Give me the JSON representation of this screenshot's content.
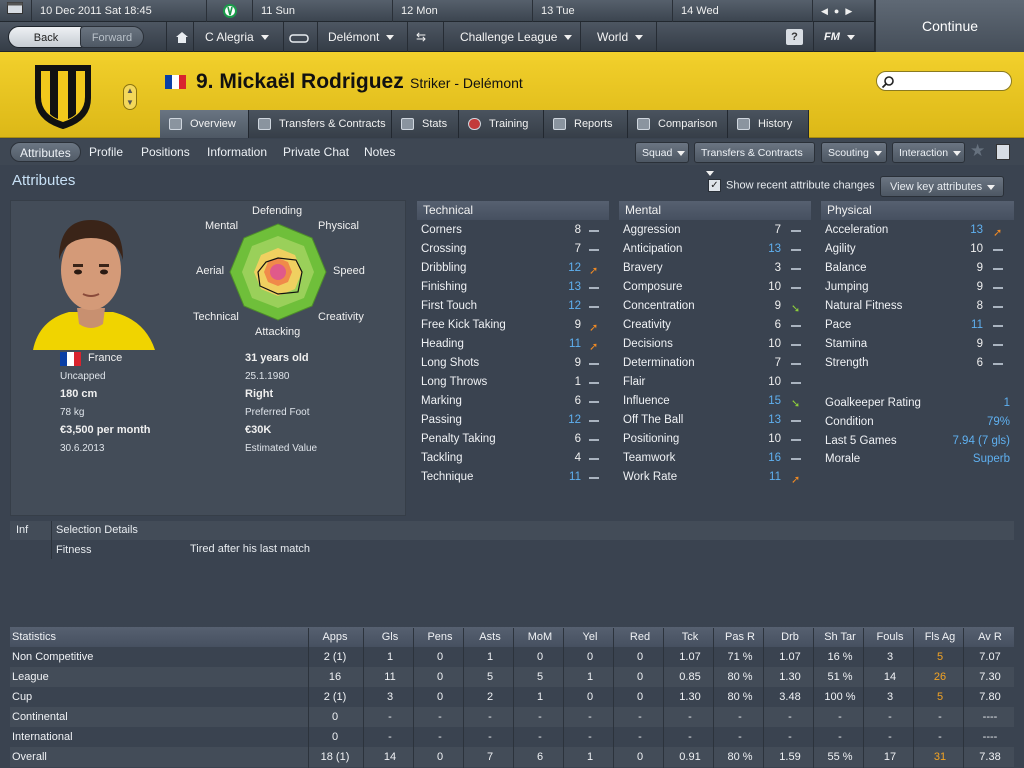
{
  "topbar": {
    "date": "10 Dec 2011 Sat  18:45",
    "days": [
      "11 Sun",
      "12 Mon",
      "13 Tue",
      "14 Wed"
    ]
  },
  "nav": {
    "back": "Back",
    "forward": "Forward",
    "club": "C Alegria",
    "team": "Delémont",
    "competition": "Challenge League",
    "world": "World",
    "help": "?",
    "fm": "FM",
    "continue": "Continue"
  },
  "player": {
    "name": "9. Mickaël Rodriguez",
    "role": "Striker - Delémont",
    "nationality": "France",
    "caps": "Uncapped",
    "height": "180 cm",
    "weight": "78 kg",
    "wage": "€3,500 per month",
    "contract_end": "30.6.2013",
    "age": "31 years old",
    "dob": "25.1.1980",
    "foot": "Right",
    "foot_label": "Preferred Foot",
    "value": "€30K",
    "value_label": "Estimated Value"
  },
  "tabs": [
    "Overview",
    "Transfers & Contracts",
    "Stats",
    "Training",
    "Reports",
    "Comparison",
    "History"
  ],
  "subnav": {
    "items": [
      "Attributes",
      "Profile",
      "Positions",
      "Information",
      "Private Chat",
      "Notes"
    ],
    "buttons": [
      "Squad",
      "Transfers & Contracts",
      "Scouting",
      "Interaction"
    ]
  },
  "attributes": {
    "title": "Attributes",
    "show_recent": "Show recent attribute changes",
    "view_key": "View key attributes",
    "spider_labels": [
      "Defending",
      "Physical",
      "Speed",
      "Creativity",
      "Attacking",
      "Technical",
      "Aerial",
      "Mental"
    ],
    "technical_header": "Technical",
    "mental_header": "Mental",
    "physical_header": "Physical",
    "technical": [
      {
        "n": "Corners",
        "v": "8",
        "c": "w",
        "t": "flat"
      },
      {
        "n": "Crossing",
        "v": "7",
        "c": "w",
        "t": "flat"
      },
      {
        "n": "Dribbling",
        "v": "12",
        "c": "bl",
        "t": "up"
      },
      {
        "n": "Finishing",
        "v": "13",
        "c": "bl",
        "t": "flat"
      },
      {
        "n": "First Touch",
        "v": "12",
        "c": "bl",
        "t": "flat"
      },
      {
        "n": "Free Kick Taking",
        "v": "9",
        "c": "w",
        "t": "up"
      },
      {
        "n": "Heading",
        "v": "11",
        "c": "bl",
        "t": "up"
      },
      {
        "n": "Long Shots",
        "v": "9",
        "c": "w",
        "t": "flat"
      },
      {
        "n": "Long Throws",
        "v": "1",
        "c": "w",
        "t": "flat"
      },
      {
        "n": "Marking",
        "v": "6",
        "c": "w",
        "t": "flat"
      },
      {
        "n": "Passing",
        "v": "12",
        "c": "bl",
        "t": "flat"
      },
      {
        "n": "Penalty Taking",
        "v": "6",
        "c": "w",
        "t": "flat"
      },
      {
        "n": "Tackling",
        "v": "4",
        "c": "w",
        "t": "flat"
      },
      {
        "n": "Technique",
        "v": "11",
        "c": "bl",
        "t": "flat"
      }
    ],
    "mental": [
      {
        "n": "Aggression",
        "v": "7",
        "c": "w",
        "t": "flat"
      },
      {
        "n": "Anticipation",
        "v": "13",
        "c": "bl",
        "t": "flat"
      },
      {
        "n": "Bravery",
        "v": "3",
        "c": "w",
        "t": "flat"
      },
      {
        "n": "Composure",
        "v": "10",
        "c": "w",
        "t": "flat"
      },
      {
        "n": "Concentration",
        "v": "9",
        "c": "w",
        "t": "down"
      },
      {
        "n": "Creativity",
        "v": "6",
        "c": "w",
        "t": "flat"
      },
      {
        "n": "Decisions",
        "v": "10",
        "c": "w",
        "t": "flat"
      },
      {
        "n": "Determination",
        "v": "7",
        "c": "w",
        "t": "flat"
      },
      {
        "n": "Flair",
        "v": "10",
        "c": "w",
        "t": "flat"
      },
      {
        "n": "Influence",
        "v": "15",
        "c": "bl",
        "t": "down"
      },
      {
        "n": "Off The Ball",
        "v": "13",
        "c": "bl",
        "t": "flat"
      },
      {
        "n": "Positioning",
        "v": "10",
        "c": "w",
        "t": "flat"
      },
      {
        "n": "Teamwork",
        "v": "16",
        "c": "bl",
        "t": "flat"
      },
      {
        "n": "Work Rate",
        "v": "11",
        "c": "bl",
        "t": "up"
      }
    ],
    "physical": [
      {
        "n": "Acceleration",
        "v": "13",
        "c": "bl",
        "t": "up"
      },
      {
        "n": "Agility",
        "v": "10",
        "c": "w",
        "t": "flat"
      },
      {
        "n": "Balance",
        "v": "9",
        "c": "w",
        "t": "flat"
      },
      {
        "n": "Jumping",
        "v": "9",
        "c": "w",
        "t": "flat"
      },
      {
        "n": "Natural Fitness",
        "v": "8",
        "c": "w",
        "t": "flat"
      },
      {
        "n": "Pace",
        "v": "11",
        "c": "bl",
        "t": "flat"
      },
      {
        "n": "Stamina",
        "v": "9",
        "c": "w",
        "t": "flat"
      },
      {
        "n": "Strength",
        "v": "6",
        "c": "w",
        "t": "flat"
      }
    ],
    "extra": [
      {
        "n": "Goalkeeper Rating",
        "v": "1"
      },
      {
        "n": "Condition",
        "v": "79%"
      },
      {
        "n": "Last 5 Games",
        "v": "7.94 (7 gls)"
      },
      {
        "n": "Morale",
        "v": "Superb"
      }
    ]
  },
  "selection": {
    "col1": "Inf",
    "col2": "Selection Details",
    "row_label": "Fitness",
    "row_value": "Tired after his last match"
  },
  "stats": {
    "headers": [
      "Statistics",
      "Apps",
      "Gls",
      "Pens",
      "Asts",
      "MoM",
      "Yel",
      "Red",
      "Tck",
      "Pas R",
      "Drb",
      "Sh Tar",
      "Fouls",
      "Fls Ag",
      "Av R"
    ],
    "rows": [
      [
        "Non Competitive",
        "2 (1)",
        "1",
        "0",
        "1",
        "0",
        "0",
        "0",
        "1.07",
        "71 %",
        "1.07",
        "16 %",
        "3",
        "5",
        "7.07"
      ],
      [
        "League",
        "16",
        "11",
        "0",
        "5",
        "5",
        "1",
        "0",
        "0.85",
        "80 %",
        "1.30",
        "51 %",
        "14",
        "26",
        "7.30"
      ],
      [
        "Cup",
        "2 (1)",
        "3",
        "0",
        "2",
        "1",
        "0",
        "0",
        "1.30",
        "80 %",
        "3.48",
        "100 %",
        "3",
        "5",
        "7.80"
      ],
      [
        "Continental",
        "0",
        "-",
        "-",
        "-",
        "-",
        "-",
        "-",
        "-",
        "-",
        "-",
        "-",
        "-",
        "-",
        "----"
      ],
      [
        "International",
        "0",
        "-",
        "-",
        "-",
        "-",
        "-",
        "-",
        "-",
        "-",
        "-",
        "-",
        "-",
        "-",
        "----"
      ],
      [
        "Overall",
        "18 (1)",
        "14",
        "0",
        "7",
        "6",
        "1",
        "0",
        "0.91",
        "80 %",
        "1.59",
        "55 %",
        "17",
        "31",
        "7.38"
      ]
    ]
  },
  "colors": {
    "header_yellow": "#e9c51f",
    "value_blue": "#5fb0f0",
    "trend_up": "#f08a24",
    "trend_down": "#8ed03a",
    "fls_ag_orange": "#f3a323"
  }
}
